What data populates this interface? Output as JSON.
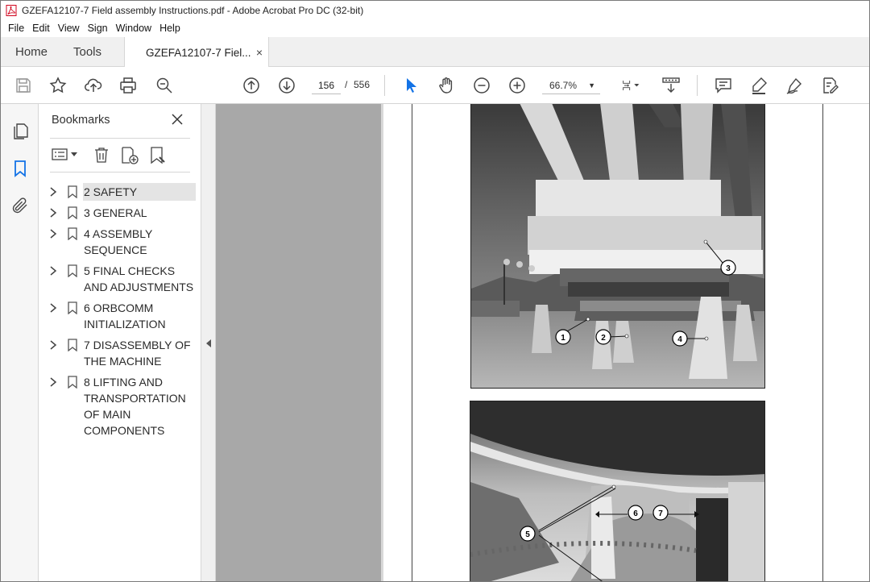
{
  "window": {
    "title": "GZEFA12107-7 Field assembly Instructions.pdf - Adobe Acrobat Pro DC (32-bit)"
  },
  "menu": [
    "File",
    "Edit",
    "View",
    "Sign",
    "Window",
    "Help"
  ],
  "tabs": {
    "home": "Home",
    "tools": "Tools",
    "document": "GZEFA12107-7 Fiel...",
    "close_glyph": "×"
  },
  "toolbar": {
    "icons": [
      "save-icon",
      "bookmark-star-icon",
      "upload-icon",
      "print-icon",
      "zoom-search-icon",
      "page-up-icon",
      "page-down-icon",
      "select-cursor-icon",
      "hand-icon",
      "zoom-out-icon",
      "zoom-in-icon",
      "page-layout-icon",
      "scroll-mode-icon",
      "comment-icon",
      "highlight-icon",
      "sign-icon",
      "edit-pdf-icon"
    ],
    "current_page": "156",
    "page_separator": "/",
    "total_pages": "556",
    "zoom": "66.7%",
    "accent_color": "#1473e6"
  },
  "bookmarks": {
    "title": "Bookmarks",
    "items": [
      {
        "label": "2 SAFETY",
        "selected": true
      },
      {
        "label": "3 GENERAL"
      },
      {
        "label": "4 ASSEMBLY SEQUENCE"
      },
      {
        "label": "5 FINAL CHECKS AND ADJUSTMENTS"
      },
      {
        "label": "6 ORBCOMM INITIALIZATION"
      },
      {
        "label": "7 DISASSEMBLY OF THE MACHINE"
      },
      {
        "label": "8 LIFTING AND TRANSPORTATION OF MAIN COMPONENTS"
      }
    ]
  },
  "figure": {
    "callouts_top": [
      "1",
      "2",
      "3",
      "4"
    ],
    "callouts_bottom": [
      "5",
      "6",
      "7"
    ]
  }
}
